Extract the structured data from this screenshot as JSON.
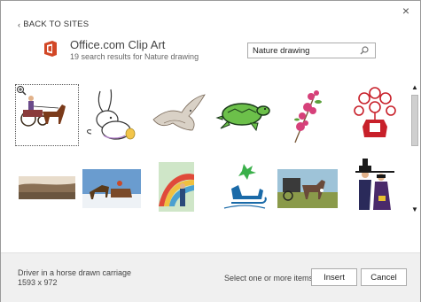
{
  "dialog": {
    "close_glyph": "×"
  },
  "nav": {
    "back_label": "BACK TO SITES",
    "back_glyph": "‹"
  },
  "source": {
    "title": "Office.com Clip Art",
    "subtitle": "19 search results for Nature drawing",
    "logo_color": "#d24726"
  },
  "search": {
    "value": "Nature drawing",
    "icon": "search-icon"
  },
  "results": [
    {
      "name": "horse-drawn-carriage",
      "selected": true
    },
    {
      "name": "bunny-with-egg"
    },
    {
      "name": "eagle-sketch"
    },
    {
      "name": "green-turtle"
    },
    {
      "name": "pink-flower-branch"
    },
    {
      "name": "red-flower-vase"
    },
    {
      "name": "desert-landscape"
    },
    {
      "name": "horse-sleigh-winter"
    },
    {
      "name": "rainbow-people-poster"
    },
    {
      "name": "blue-sleigh"
    },
    {
      "name": "horse-buggy-rural"
    },
    {
      "name": "amish-couple"
    }
  ],
  "scrollbar": {
    "up_glyph": "▲",
    "down_glyph": "▼"
  },
  "footer": {
    "selected_name": "Driver in a horse drawn carriage",
    "selected_dims": "1593 x 972",
    "hint": "Select one or more items.",
    "insert_label": "Insert",
    "cancel_label": "Cancel"
  },
  "colors": {
    "accent": "#d24726",
    "border": "#ababab",
    "footer_bg": "#f0f0f0"
  }
}
